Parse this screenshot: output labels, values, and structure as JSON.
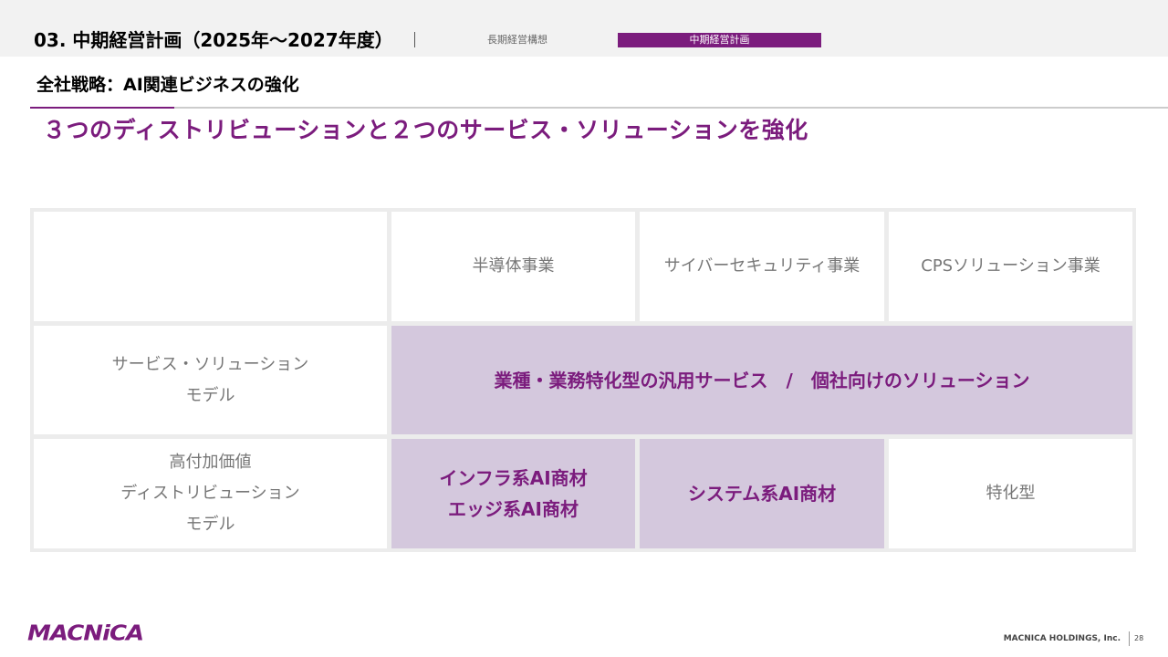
{
  "header": {
    "section_title": "03. 中期経営計画（2025年～2027年度）",
    "nav_tabs": [
      {
        "label": "長期経営構想",
        "active": false
      },
      {
        "label": "中期経営計画",
        "active": true
      }
    ]
  },
  "subheading": "全社戦略：AI関連ビジネスの強化",
  "headline": "３つのディストリビューションと２つのサービス・ソリューションを強化",
  "matrix": {
    "column_headers": [
      "",
      "半導体事業",
      "サイバーセキュリティ事業",
      "CPSソリューション事業"
    ],
    "rows": [
      {
        "label_lines": [
          "サービス・ソリューション",
          "モデル"
        ],
        "merged_cell": "業種・業務特化型の汎用サービス　/　個社向けのソリューション"
      },
      {
        "label_lines": [
          "高付加価値",
          "ディストリビューション",
          "モデル"
        ],
        "cells": [
          {
            "lines": [
              "インフラ系AI商材",
              "エッジ系AI商材"
            ],
            "highlighted": true
          },
          {
            "lines": [
              "システム系AI商材"
            ],
            "highlighted": true
          },
          {
            "lines": [
              "特化型"
            ],
            "highlighted": false
          }
        ]
      }
    ]
  },
  "footer": {
    "logo_text": "MACNiCA",
    "company": "MACNICA HOLDINGS, Inc.",
    "page_number": "28"
  },
  "colors": {
    "accent_purple": "#7b1c7d",
    "highlight_lavender": "#d4c8dd",
    "header_band": "#f2f2f2",
    "grid_gap": "#ececec"
  }
}
